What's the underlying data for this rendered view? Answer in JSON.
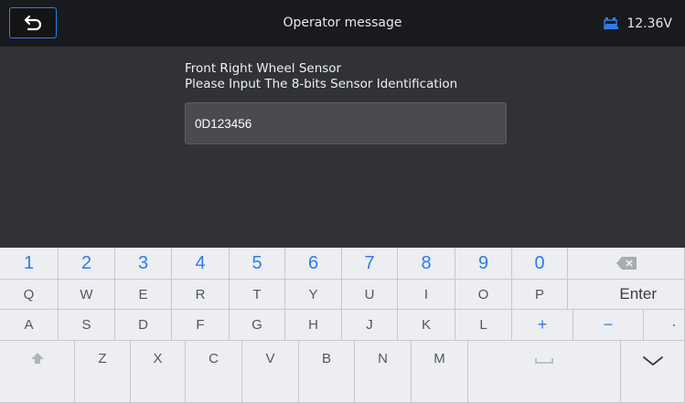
{
  "header": {
    "title": "Operator message",
    "battery_voltage": "12.36V",
    "back_icon": "back-arrow-icon",
    "battery_icon": "car-battery-icon",
    "accent_color": "#2d7df2"
  },
  "message": {
    "line1": "Front Right Wheel Sensor",
    "line2": "Please Input The 8-bits Sensor Identification"
  },
  "input": {
    "value": "0D123456"
  },
  "keyboard": {
    "row1": [
      "1",
      "2",
      "3",
      "4",
      "5",
      "6",
      "7",
      "8",
      "9",
      "0"
    ],
    "row2": [
      "Q",
      "W",
      "E",
      "R",
      "T",
      "Y",
      "U",
      "I",
      "O",
      "P"
    ],
    "enter_label": "Enter",
    "row3": [
      "A",
      "S",
      "D",
      "F",
      "G",
      "H",
      "J",
      "K",
      "L",
      "+",
      "−",
      "·"
    ],
    "row4": [
      "Z",
      "X",
      "C",
      "V",
      "B",
      "N",
      "M"
    ],
    "icons": [
      "backspace-icon",
      "shift-icon",
      "space-icon",
      "hide-keyboard-icon"
    ]
  }
}
